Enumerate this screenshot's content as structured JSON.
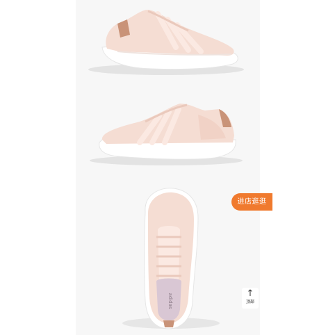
{
  "gallery": {
    "images": [
      {
        "name": "Side view of light pink running shoe"
      },
      {
        "name": "Inner side view of light pink running shoe"
      },
      {
        "name": "Top view of light pink running shoe"
      }
    ],
    "brand_text": "adidas",
    "colors": {
      "upper": "#f5ddd3",
      "upper_shadow": "#eac9bc",
      "stripes": "#fbe9e2",
      "sole": "#ffffff",
      "heel_tab": "#c99378",
      "lining": "#d9c7d4",
      "background": "#f7f7f7"
    }
  },
  "store_button": {
    "label": "进店逛逛",
    "color": "#f07a2e"
  },
  "back_to_top": {
    "icon": "arrow-up-icon",
    "label": "顶部"
  }
}
